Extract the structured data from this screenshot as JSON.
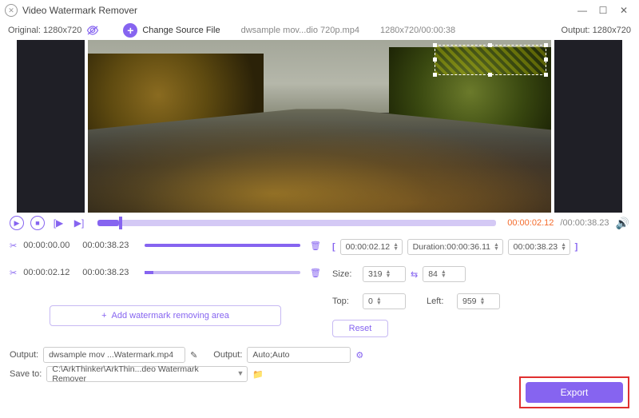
{
  "titlebar": {
    "app_name": "Video Watermark Remover"
  },
  "top": {
    "original_label": "Original: 1280x720",
    "change_source_label": "Change Source File",
    "file_name": "dwsample mov...dio 720p.mp4",
    "file_res_time": "1280x720/00:00:38",
    "output_label": "Output: 1280x720"
  },
  "playback": {
    "current": "00:00:02.12",
    "total": "00:00:38.23"
  },
  "segments": [
    {
      "start": "00:00:00.00",
      "end": "00:00:38.23"
    },
    {
      "start": "00:00:02.12",
      "end": "00:00:38.23"
    }
  ],
  "add_area_label": "Add watermark removing area",
  "range": {
    "start": "00:00:02.12",
    "duration_label": "Duration:00:00:36.11",
    "end": "00:00:38.23"
  },
  "size": {
    "label": "Size:",
    "w": "319",
    "h": "84"
  },
  "pos": {
    "top_label": "Top:",
    "top": "0",
    "left_label": "Left:",
    "left": "959"
  },
  "reset_label": "Reset",
  "output": {
    "output_label": "Output:",
    "filename": "dwsample mov ...Watermark.mp4",
    "format_label": "Output:",
    "format_value": "Auto;Auto"
  },
  "saveto": {
    "label": "Save to:",
    "path": "C:\\ArkThinker\\ArkThin...deo Watermark Remover"
  },
  "export_label": "Export"
}
